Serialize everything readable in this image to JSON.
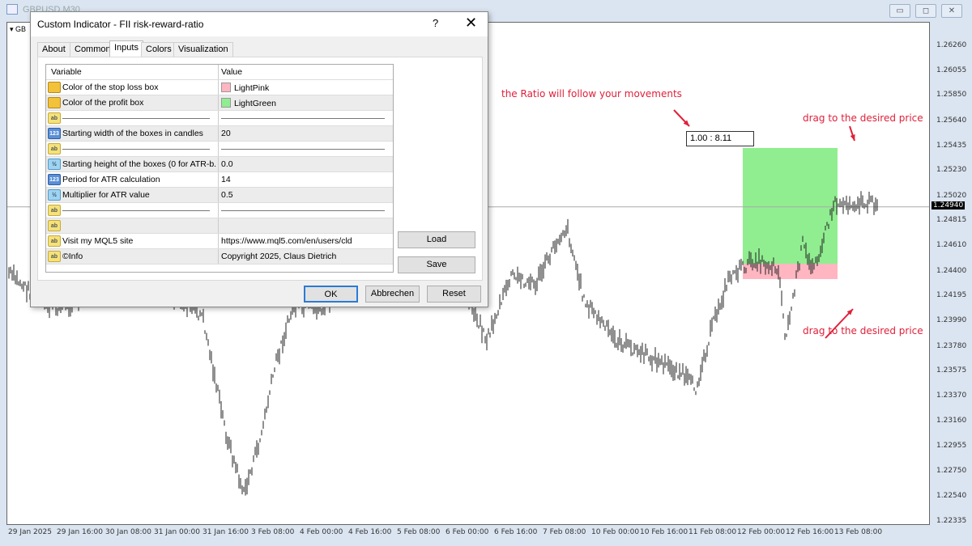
{
  "window": {
    "title": "GBPUSD,M30",
    "symbol_short": "GB"
  },
  "dialog": {
    "title": "Custom Indicator - FII risk-reward-ratio",
    "help": "?",
    "close": "✕",
    "tabs": [
      {
        "label": "About"
      },
      {
        "label": "Common"
      },
      {
        "label": "Inputs",
        "active": true
      },
      {
        "label": "Colors"
      },
      {
        "label": "Visualization"
      }
    ],
    "columns": {
      "variable": "Variable",
      "value": "Value"
    },
    "rows": [
      {
        "icon": "color",
        "variable": "Color of the stop loss box",
        "value": "LightPink",
        "swatch": "#ffb6c1"
      },
      {
        "icon": "color",
        "variable": "Color of the profit box",
        "value": "LightGreen",
        "swatch": "#90ee90"
      },
      {
        "icon": "string",
        "variable": "",
        "value": "",
        "separator": true
      },
      {
        "icon": "int",
        "variable": "Starting width of the boxes in candles",
        "value": "20"
      },
      {
        "icon": "string",
        "variable": "",
        "value": "",
        "separator": true
      },
      {
        "icon": "double",
        "variable": "Starting height of the boxes (0 for ATR-b...",
        "value": "0.0"
      },
      {
        "icon": "int",
        "variable": "Period for ATR calculation",
        "value": "14"
      },
      {
        "icon": "double",
        "variable": "Multiplier for ATR value",
        "value": "0.5"
      },
      {
        "icon": "string",
        "variable": "",
        "value": "",
        "separator": true
      },
      {
        "icon": "string",
        "variable": "",
        "value": ""
      },
      {
        "icon": "string",
        "variable": "Visit my MQL5 site",
        "value": "https://www.mql5.com/en/users/cld"
      },
      {
        "icon": "string",
        "variable": "©Info",
        "value": "Copyright 2025, Claus Dietrich"
      }
    ],
    "icon_labels": {
      "string": "ab",
      "int": "123",
      "double": "½",
      "color": ""
    },
    "buttons": {
      "load": "Load",
      "save": "Save",
      "ok": "OK",
      "cancel": "Abbrechen",
      "reset": "Reset"
    }
  },
  "annotations": {
    "ratio_hint": "the Ratio will follow your movements",
    "drag_top": "drag to the desired price",
    "drag_bottom": "drag to the desired price",
    "ratio_value": "1.00 : 8.11"
  },
  "colors": {
    "profit": "#90ee90",
    "loss": "#ffb6c1",
    "annotation": "#e0203a"
  },
  "chart_data": {
    "type": "candlestick",
    "price_ticks": [
      "1.26260",
      "1.26055",
      "1.25850",
      "1.25640",
      "1.25435",
      "1.25230",
      "1.25020",
      "1.24815",
      "1.24610",
      "1.24400",
      "1.24195",
      "1.23990",
      "1.23780",
      "1.23575",
      "1.23370",
      "1.23160",
      "1.22955",
      "1.22750",
      "1.22540",
      "1.22335"
    ],
    "ylim": [
      1.22335,
      1.2626
    ],
    "current_price": "1.24940",
    "time_ticks": [
      "29 Jan 2025",
      "29 Jan 16:00",
      "30 Jan 08:00",
      "31 Jan 00:00",
      "31 Jan 16:00",
      "3 Feb 08:00",
      "4 Feb 00:00",
      "4 Feb 16:00",
      "5 Feb 08:00",
      "6 Feb 00:00",
      "6 Feb 16:00",
      "7 Feb 08:00",
      "10 Feb 00:00",
      "10 Feb 16:00",
      "11 Feb 08:00",
      "12 Feb 00:00",
      "12 Feb 16:00",
      "13 Feb 08:00"
    ],
    "price_path": [
      [
        -0.4,
        1.244
      ],
      [
        0.45,
        1.241
      ],
      [
        1.1,
        1.2416
      ],
      [
        1.95,
        1.243
      ],
      [
        2.8,
        1.2423
      ],
      [
        3.6,
        1.2404
      ],
      [
        4.1,
        1.2304
      ],
      [
        4.45,
        1.2257
      ],
      [
        4.8,
        1.2304
      ],
      [
        5.1,
        1.2364
      ],
      [
        5.45,
        1.241
      ],
      [
        6.1,
        1.241
      ],
      [
        6.6,
        1.243
      ],
      [
        7.3,
        1.2444
      ],
      [
        8.8,
        1.2444
      ],
      [
        9.45,
        1.2384
      ],
      [
        9.95,
        1.2437
      ],
      [
        10.45,
        1.243
      ],
      [
        10.95,
        1.247
      ],
      [
        11.1,
        1.2477
      ],
      [
        11.45,
        1.2417
      ],
      [
        12.1,
        1.2384
      ],
      [
        12.8,
        1.237
      ],
      [
        13.45,
        1.2357
      ],
      [
        13.75,
        1.2344
      ],
      [
        14.1,
        1.2397
      ],
      [
        14.45,
        1.2437
      ],
      [
        14.95,
        1.245
      ],
      [
        15.45,
        1.2444
      ],
      [
        15.6,
        1.2384
      ],
      [
        15.8,
        1.243
      ],
      [
        15.95,
        1.2464
      ],
      [
        16.1,
        1.2444
      ],
      [
        16.3,
        1.2457
      ],
      [
        16.45,
        1.2477
      ],
      [
        16.6,
        1.2497
      ]
    ],
    "rr_box": {
      "profit_top": 1.25426,
      "entry": 1.24471,
      "stop": 1.24344,
      "start": "12 Feb 00:00",
      "width_candles": 20
    }
  }
}
